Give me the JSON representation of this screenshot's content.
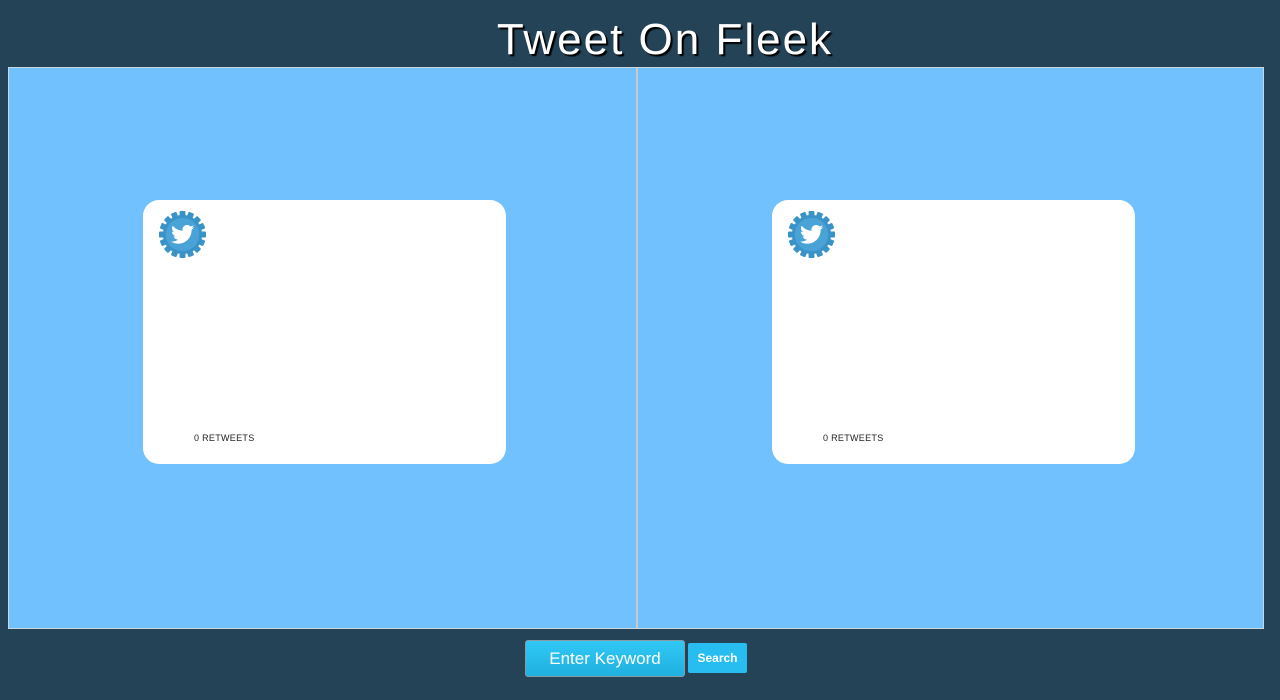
{
  "header": {
    "title": "Tweet On Fleek"
  },
  "cards": [
    {
      "icon": "twitter-gear-icon",
      "retweets_text": "0 RETWEETS"
    },
    {
      "icon": "twitter-gear-icon",
      "retweets_text": "0 RETWEETS"
    }
  ],
  "search": {
    "placeholder": "Enter Keyword",
    "value": "",
    "button_label": "Search"
  },
  "colors": {
    "page_background": "#244357",
    "stage_background": "#70c1fd",
    "card_background": "#ffffff",
    "accent": "#27bdf0",
    "icon_blue": "#3a93c8"
  }
}
